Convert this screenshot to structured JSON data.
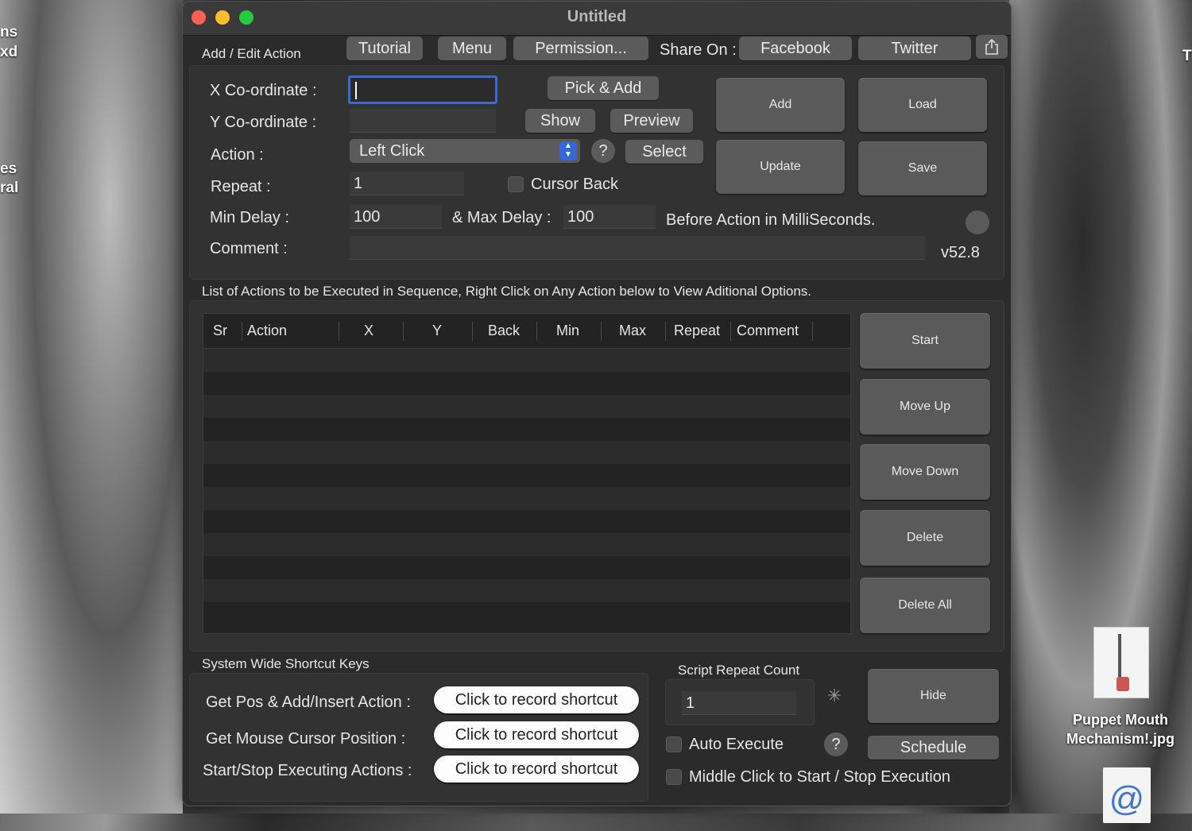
{
  "desktop": {
    "left_text": [
      "ns",
      "xd",
      "es",
      "ral"
    ],
    "right_text": "T",
    "file1_name": "Puppet Mouth Mechanism!.jpg",
    "file2_glyph": "@"
  },
  "window": {
    "title": "Untitled"
  },
  "toolbar": {
    "section_label": "Add / Edit Action",
    "tutorial": "Tutorial",
    "menu": "Menu",
    "permission": "Permission...",
    "share_on": "Share On :",
    "facebook": "Facebook",
    "twitter": "Twitter",
    "share_icon": "share-icon"
  },
  "form": {
    "x_label": "X Co-ordinate :",
    "x_value": "",
    "y_label": "Y Co-ordinate :",
    "y_value": "",
    "action_label": "Action :",
    "action_value": "Left Click",
    "repeat_label": "Repeat :",
    "repeat_value": "1",
    "min_delay_label": "Min Delay :",
    "min_delay_value": "100",
    "max_delay_label": "& Max Delay :",
    "max_delay_value": "100",
    "delay_suffix": "Before Action in MilliSeconds.",
    "comment_label": "Comment :",
    "comment_value": "",
    "pick_add": "Pick & Add",
    "show": "Show",
    "preview": "Preview",
    "help": "?",
    "select": "Select",
    "cursor_back": "Cursor Back",
    "version": "v52.8"
  },
  "side_buttons": {
    "add": "Add",
    "load": "Load",
    "update": "Update",
    "save": "Save"
  },
  "list": {
    "caption": "List of Actions to be Executed in Sequence, Right Click on Any Action below to View Aditional Options.",
    "columns": [
      "Sr",
      "Action",
      "X",
      "Y",
      "Back",
      "Min",
      "Max",
      "Repeat",
      "Comment"
    ],
    "rows": []
  },
  "list_buttons": {
    "start": "Start",
    "move_up": "Move Up",
    "move_down": "Move Down",
    "delete": "Delete",
    "delete_all": "Delete All"
  },
  "shortcuts": {
    "title": "System Wide Shortcut Keys",
    "get_pos_label": "Get Pos & Add/Insert Action :",
    "get_mouse_label": "Get Mouse Cursor Position :",
    "start_stop_label": "Start/Stop Executing Actions :",
    "record_label": "Click to record shortcut"
  },
  "script": {
    "repeat_count_label": "Script Repeat Count",
    "repeat_count_value": "1",
    "hide": "Hide",
    "auto_execute": "Auto Execute",
    "help": "?",
    "schedule": "Schedule",
    "middle_click": "Middle Click to Start / Stop Execution"
  },
  "colors": {
    "window_bg": "#2b2b2b",
    "button_bg": "#5b5b5b",
    "focus_ring": "#3b6ad3",
    "accent_blue": "#3567d6",
    "traffic_red": "#ff5f57",
    "traffic_yellow": "#febc2e",
    "traffic_green": "#28c840"
  }
}
